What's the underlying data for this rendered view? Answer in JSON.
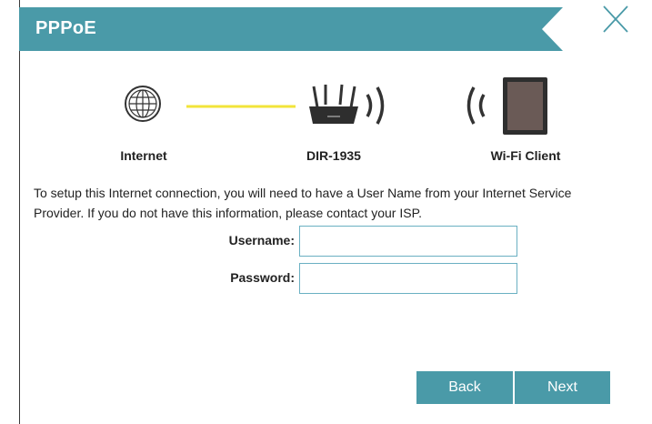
{
  "header": {
    "title": "PPPoE",
    "color": "#4a9aa8"
  },
  "diagram": {
    "internet_label": "Internet",
    "router_label": "DIR-1935",
    "client_label": "Wi-Fi Client",
    "link_color": "#f2e43a"
  },
  "description": "To setup this Internet connection, you will need to have a User Name from your Internet Service Provider. If you do not have this information, please contact your ISP.",
  "form": {
    "username_label": "Username:",
    "username_value": "",
    "password_label": "Password:",
    "password_value": ""
  },
  "buttons": {
    "back": "Back",
    "next": "Next"
  },
  "icons": {
    "close": "close-icon",
    "internet": "globe-icon",
    "router": "router-icon",
    "client": "tablet-icon"
  }
}
